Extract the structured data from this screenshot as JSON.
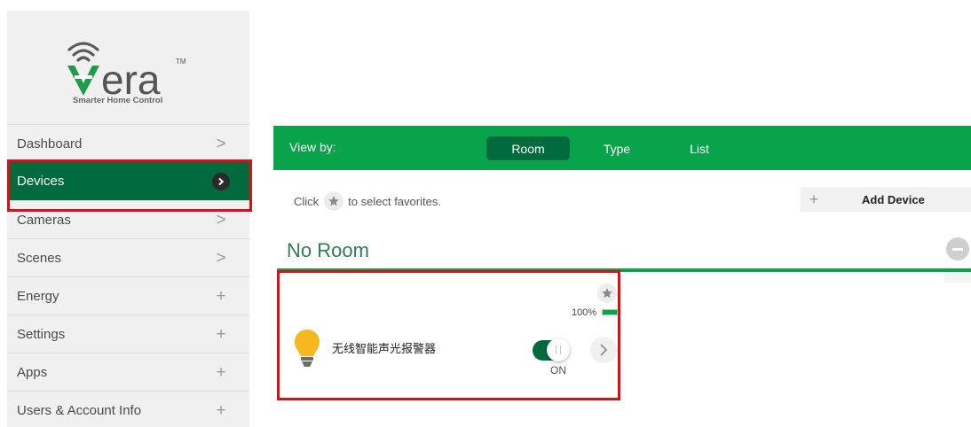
{
  "brand": {
    "wordmark": "vera",
    "trademark": "TM",
    "tagline": "Smarter Home Control"
  },
  "sidebar": {
    "items": [
      {
        "label": "Dashboard",
        "indicator": ">",
        "active": false
      },
      {
        "label": "Devices",
        "indicator": ">",
        "active": true
      },
      {
        "label": "Cameras",
        "indicator": ">",
        "active": false
      },
      {
        "label": "Scenes",
        "indicator": ">",
        "active": false
      },
      {
        "label": "Energy",
        "indicator": "+",
        "active": false
      },
      {
        "label": "Settings",
        "indicator": "+",
        "active": false
      },
      {
        "label": "Apps",
        "indicator": "+",
        "active": false
      },
      {
        "label": "Users & Account Info",
        "indicator": "+",
        "active": false
      }
    ]
  },
  "view_by": {
    "label": "View by:",
    "options": [
      "Room",
      "Type",
      "List"
    ],
    "selected": "Room"
  },
  "favorites_hint": {
    "before": "Click",
    "after": "to select favorites."
  },
  "add_device": {
    "icon": "+",
    "label": "Add Device"
  },
  "room": {
    "title": "No Room",
    "devices": [
      {
        "name": "无线智能声光报警器",
        "battery_text": "100%",
        "battery_level": 1.0,
        "state_label": "ON",
        "is_on": true,
        "icon": "light-bulb-icon",
        "favorite": false
      }
    ]
  },
  "colors": {
    "sidebar_bg": "#f0f0f0",
    "active_nav": "#016b3d",
    "view_bar": "#08a34a",
    "selected_view": "#016b3d",
    "bulb": "#f5b81d",
    "annotation_red": "#d9101a"
  },
  "icons": {
    "nav_chevron": "chevron-right-icon",
    "nav_expand": "plus-icon",
    "favorite": "star-icon",
    "collapse": "minus-circle-icon",
    "device_detail": "chevron-right-icon",
    "wifi": "wifi-signal-icon"
  }
}
